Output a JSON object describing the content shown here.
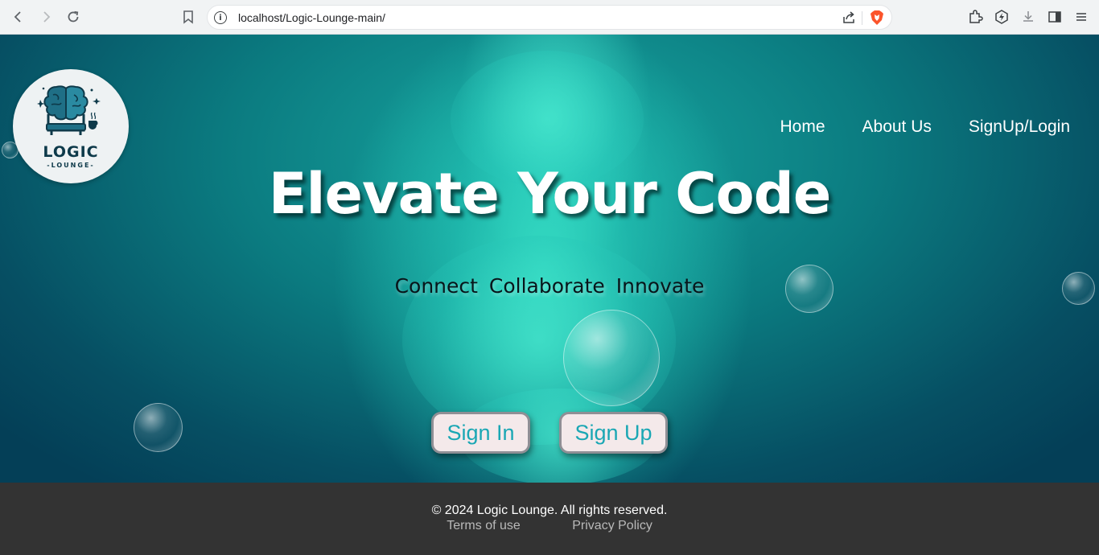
{
  "browser": {
    "url": "localhost/Logic-Lounge-main/",
    "icons": [
      "back-icon",
      "forward-icon",
      "reload-icon",
      "bookmark-icon",
      "site-info-icon",
      "share-icon",
      "brave-shield-icon",
      "extensions-icon",
      "leo-icon",
      "download-icon",
      "sidebar-icon",
      "menu-icon"
    ]
  },
  "logo": {
    "title": "LOGIC",
    "subtitle": "-LOUNGE-"
  },
  "nav": {
    "items": [
      "Home",
      "About Us",
      "SignUp/Login"
    ]
  },
  "hero": {
    "headline": "Elevate Your Code",
    "tagline": "Connect  Collaborate  Innovate",
    "signin_label": "Sign In",
    "signup_label": "Sign Up"
  },
  "footer": {
    "copyright": "© 2024 Logic Lounge. All rights reserved.",
    "links": [
      "Terms of use",
      "Privacy Policy"
    ]
  },
  "colors": {
    "footer_bg": "#333333",
    "button_text": "#1aa7b4",
    "hero_teal": "#18a7a1"
  }
}
